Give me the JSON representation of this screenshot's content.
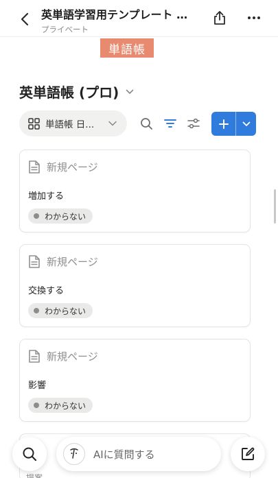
{
  "header": {
    "title": "英単語学習用テンプレート …",
    "subtitle": "プライベート"
  },
  "highlight_label": "単語帳",
  "database": {
    "title": "英単語帳 (プロ)"
  },
  "toolbar": {
    "view_label": "単語帳 日...",
    "accent_color": "#2f7cdc"
  },
  "cards": [
    {
      "page_title": "新規ページ",
      "word": "増加する",
      "status": "わからない"
    },
    {
      "page_title": "新規ページ",
      "word": "交換する",
      "status": "わからない"
    },
    {
      "page_title": "新規ページ",
      "word": "影響",
      "status": "わからない"
    }
  ],
  "partial_card": {
    "word": "提案"
  },
  "bottom_bar": {
    "ai_placeholder": "AIに質問する"
  }
}
